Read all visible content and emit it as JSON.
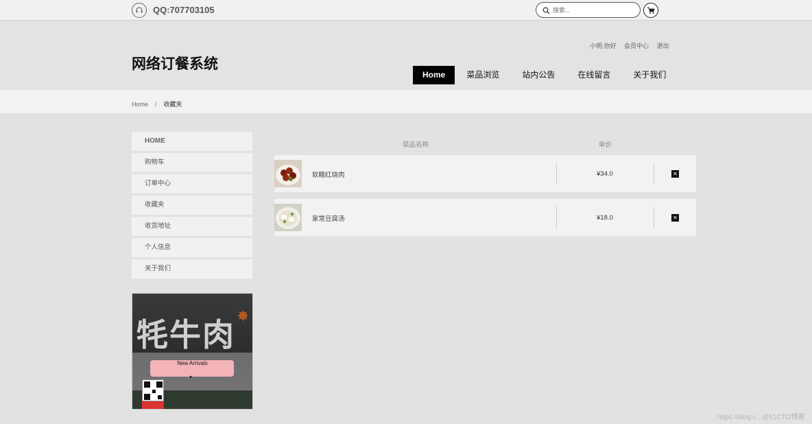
{
  "topbar": {
    "qq": "QQ:707703105",
    "search_placeholder": "搜索..."
  },
  "header": {
    "logo": "网络订餐系统",
    "user_links": [
      "小明,你好",
      "会员中心",
      "退出"
    ],
    "nav": [
      "Home",
      "菜品浏览",
      "站内公告",
      "在线留言",
      "关于我们"
    ],
    "active_nav": "Home"
  },
  "breadcrumb": {
    "home": "Home",
    "separator": "/",
    "current": "收藏夹"
  },
  "sidebar": {
    "items": [
      "HOME",
      "购物车",
      "订单中心",
      "收藏夹",
      "收货地址",
      "个人信息",
      "关于我们"
    ]
  },
  "promo": {
    "title": "牦牛肉",
    "caption": "New Arrivals"
  },
  "table": {
    "headers": {
      "name": "菜品名称",
      "price": "单价"
    },
    "rows": [
      {
        "name": "软糯红烧肉",
        "price": "¥34.0"
      },
      {
        "name": "家常豆腐汤",
        "price": "¥18.0"
      }
    ]
  },
  "watermark": "https://blog.c...@51CTO博客",
  "colors": {
    "nav_active_bg": "#000000",
    "page_bg": "#e2e2e2",
    "row_bg": "#f2f2f2"
  }
}
